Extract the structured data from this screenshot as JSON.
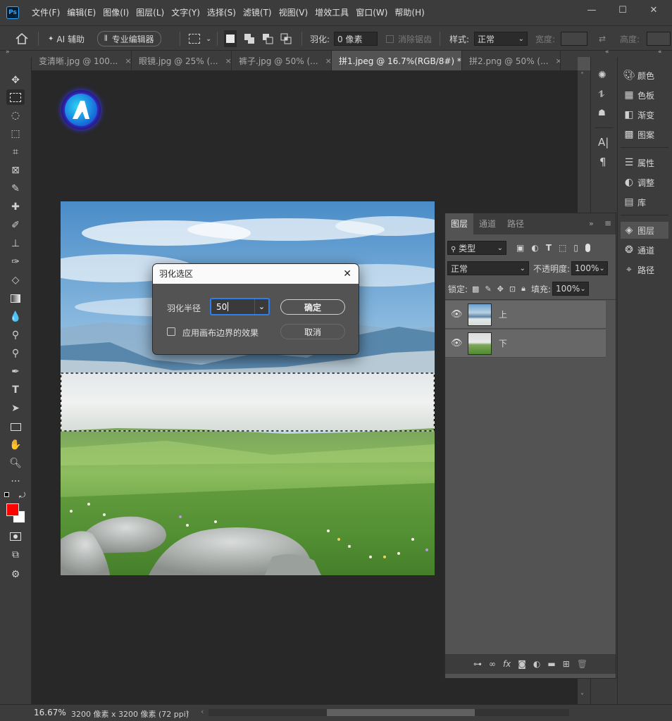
{
  "app": {
    "logo": "Ps"
  },
  "menu": [
    "文件(F)",
    "编辑(E)",
    "图像(I)",
    "图层(L)",
    "文字(Y)",
    "选择(S)",
    "滤镜(T)",
    "视图(V)",
    "增效工具",
    "窗口(W)",
    "帮助(H)"
  ],
  "window_controls": {
    "min": "—",
    "max": "☐",
    "close": "✕"
  },
  "options_bar": {
    "home_icon": "home-icon",
    "ai_label": "AI 辅助",
    "pro_editor": "专业编辑器",
    "feather_label": "羽化:",
    "feather_value": "0 像素",
    "antialias_label": "消除锯齿",
    "style_label": "样式:",
    "style_value": "正常",
    "width_label": "宽度:",
    "height_label": "高度:"
  },
  "tabs": [
    {
      "label": "变清晰.jpg @ 100...",
      "close": "×",
      "active": false
    },
    {
      "label": "眼镜.jpg @ 25% (...",
      "close": "×",
      "active": false
    },
    {
      "label": "裤子.jpg @ 50% (...",
      "close": "×",
      "active": false
    },
    {
      "label": "拼1.jpeg @ 16.7%(RGB/8#) *",
      "close": "×",
      "active": true
    },
    {
      "label": "拼2.png @ 50% (...",
      "close": "×",
      "active": false
    }
  ],
  "tools": [
    "move-tool",
    "marquee-tool",
    "lasso-tool",
    "object-select-tool",
    "crop-tool",
    "frame-tool",
    "eyedropper-tool",
    "healing-tool",
    "brush-tool",
    "stamp-tool",
    "history-brush-tool",
    "eraser-tool",
    "gradient-tool",
    "blur-tool",
    "dodge-tool",
    "zoom-lens-tool",
    "pen-tool",
    "type-tool",
    "path-select-tool",
    "rectangle-tool",
    "hand-tool",
    "zoom-tool",
    "more-tools"
  ],
  "colors": {
    "foreground": "#ff0000",
    "background": "#ffffff",
    "accent": "#2d7ef0"
  },
  "right_panel": {
    "group1": [
      {
        "icon": "palette-icon",
        "label": "颜色"
      },
      {
        "icon": "grid-icon",
        "label": "色板"
      },
      {
        "icon": "gradient-icon",
        "label": "渐变"
      },
      {
        "icon": "pattern-icon",
        "label": "图案"
      }
    ],
    "group2": [
      {
        "icon": "properties-icon",
        "label": "属性"
      },
      {
        "icon": "adjust-icon",
        "label": "调整"
      },
      {
        "icon": "library-icon",
        "label": "库"
      }
    ],
    "group3": [
      {
        "icon": "layers-icon",
        "label": "图层",
        "active": true
      },
      {
        "icon": "channels-icon",
        "label": "通道",
        "active": false
      },
      {
        "icon": "paths-icon",
        "label": "路径",
        "active": false
      }
    ]
  },
  "layers_panel": {
    "tabs": [
      "图层",
      "通道",
      "路径"
    ],
    "filter_label": "类型",
    "blend_mode": "正常",
    "opacity_label": "不透明度:",
    "opacity_value": "100%",
    "lock_label": "锁定:",
    "fill_label": "填充:",
    "fill_value": "100%",
    "layers": [
      {
        "name": "上"
      },
      {
        "name": "下"
      }
    ],
    "footer_fx": "fx"
  },
  "dialog": {
    "title": "羽化选区",
    "radius_label": "羽化半径",
    "radius_value": "50",
    "checkbox_label": "应用画布边界的效果",
    "ok": "确定",
    "cancel": "取消"
  },
  "status": {
    "zoom": "16.67%",
    "info": "3200 像素 x 3200 像素 (72 ppi)",
    "arrow": "›"
  }
}
